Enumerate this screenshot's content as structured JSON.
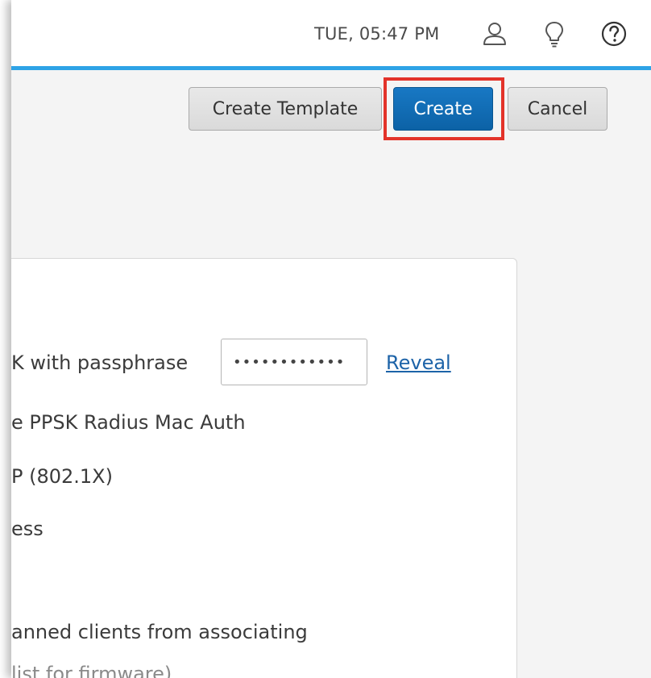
{
  "header": {
    "clock": "TUE, 05:47 PM",
    "icons": {
      "user": "user-icon",
      "tips": "lightbulb-icon",
      "help": "help-icon"
    },
    "accent_color": "#2ea3e6"
  },
  "toolbar": {
    "create_template_label": "Create Template",
    "create_label": "Create",
    "cancel_label": "Cancel",
    "highlight_color": "#e3332a"
  },
  "form": {
    "ppsk_label": "K with passphrase",
    "passphrase_value": "••••••••••••",
    "reveal_label": "Reveal",
    "radius_mac_label": "e PPSK Radius Mac Auth",
    "eap_label": "P (802.1X)",
    "open_label": "ess",
    "ban_label": "anned clients from associating",
    "firmware_hint": "list for firmware)"
  }
}
